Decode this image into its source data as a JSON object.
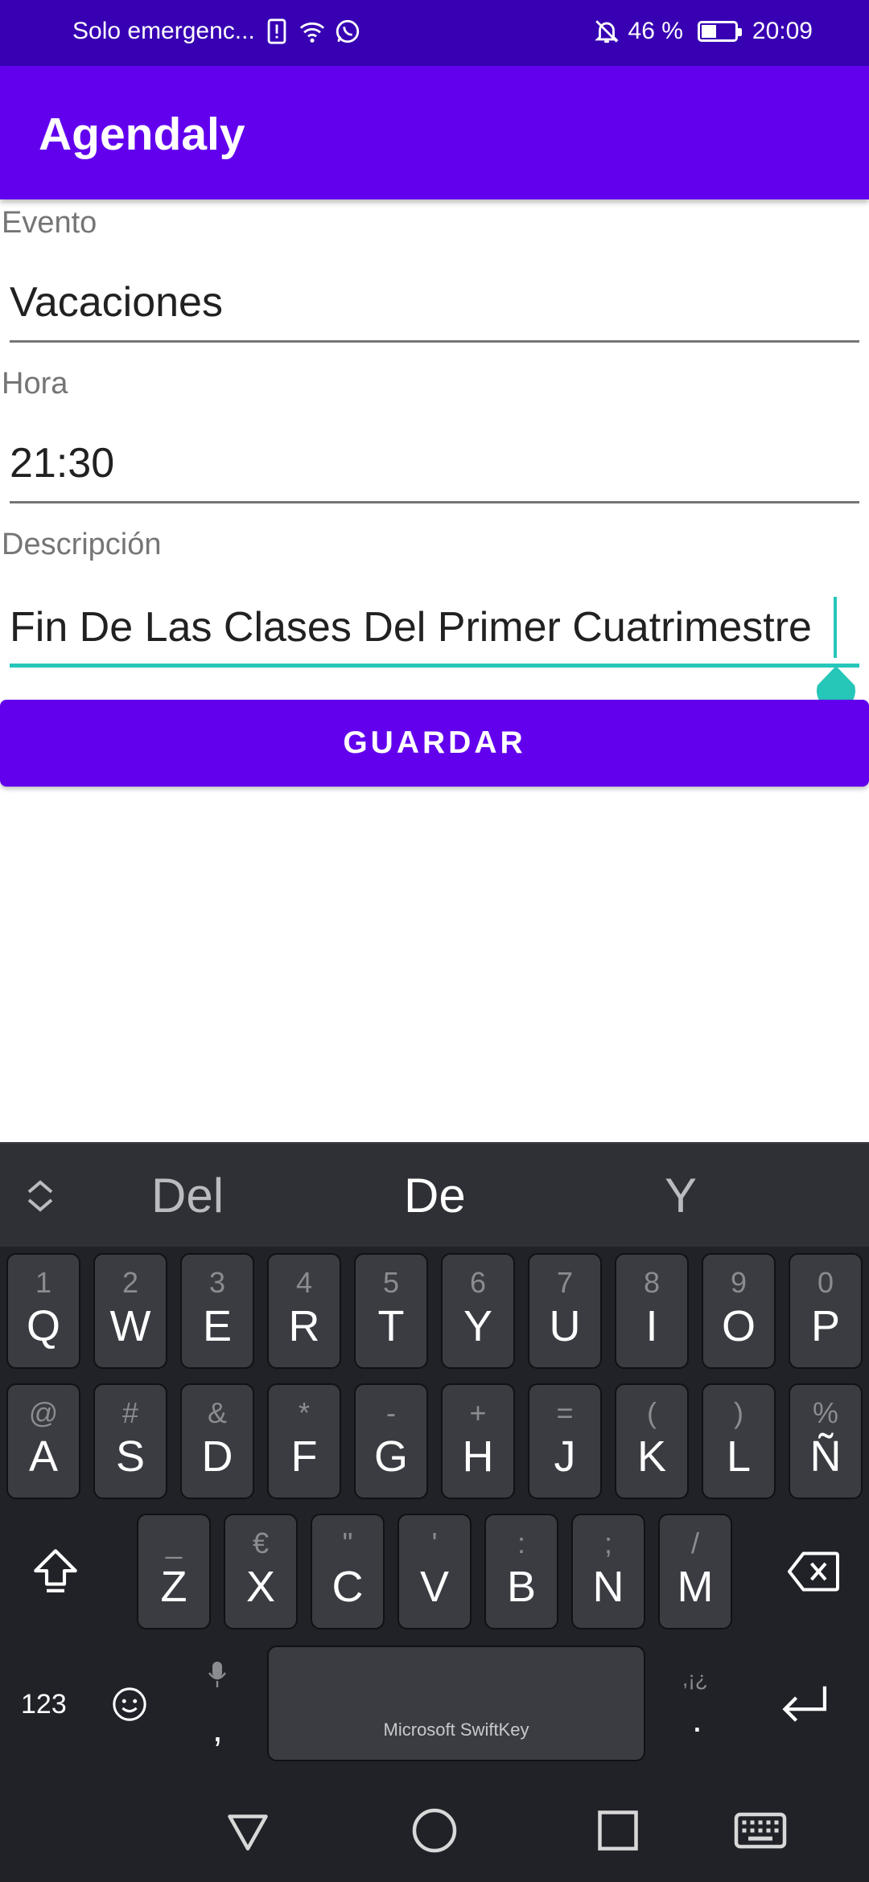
{
  "status_bar": {
    "carrier": "Solo emergenc...",
    "battery_percent": "46 %",
    "battery_level": 0.46,
    "time": "20:09"
  },
  "app_bar": {
    "title": "Agendaly"
  },
  "form": {
    "event_label": "Evento",
    "event_value": "Vacaciones",
    "time_label": "Hora",
    "time_value": "21:30",
    "description_label": "Descripción",
    "description_value": "Fin De Las Clases Del Primer Cuatrimestre",
    "save_label": "GUARDAR"
  },
  "keyboard": {
    "suggestions": [
      "Del",
      "De",
      "Y"
    ],
    "row1": [
      {
        "main": "Q",
        "hint": "1"
      },
      {
        "main": "W",
        "hint": "2"
      },
      {
        "main": "E",
        "hint": "3"
      },
      {
        "main": "R",
        "hint": "4"
      },
      {
        "main": "T",
        "hint": "5"
      },
      {
        "main": "Y",
        "hint": "6"
      },
      {
        "main": "U",
        "hint": "7"
      },
      {
        "main": "I",
        "hint": "8"
      },
      {
        "main": "O",
        "hint": "9"
      },
      {
        "main": "P",
        "hint": "0"
      }
    ],
    "row2": [
      {
        "main": "A",
        "hint": "@"
      },
      {
        "main": "S",
        "hint": "#"
      },
      {
        "main": "D",
        "hint": "&"
      },
      {
        "main": "F",
        "hint": "*"
      },
      {
        "main": "G",
        "hint": "-"
      },
      {
        "main": "H",
        "hint": "+"
      },
      {
        "main": "J",
        "hint": "="
      },
      {
        "main": "K",
        "hint": "("
      },
      {
        "main": "L",
        "hint": ")"
      },
      {
        "main": "Ñ",
        "hint": "%"
      }
    ],
    "row3": [
      {
        "main": "Z",
        "hint": "_"
      },
      {
        "main": "X",
        "hint": "€"
      },
      {
        "main": "C",
        "hint": "\""
      },
      {
        "main": "V",
        "hint": "'"
      },
      {
        "main": "B",
        "hint": ":"
      },
      {
        "main": "N",
        "hint": ";"
      },
      {
        "main": "M",
        "hint": "/"
      }
    ],
    "numbers_label": "123",
    "comma_label": ",",
    "space_brand": "Microsoft SwiftKey",
    "period_label": ".",
    "punct_hint": ",¡¿"
  },
  "icons": {
    "alert": "alert-icon",
    "wifi": "wifi-icon",
    "whatsapp": "whatsapp-icon",
    "mute": "notifications-off-icon",
    "battery": "battery-icon",
    "shift": "shift-icon",
    "backspace": "backspace-icon",
    "emoji": "emoji-icon",
    "mic": "mic-icon",
    "enter": "enter-icon",
    "back": "back-icon",
    "home": "home-icon",
    "recents": "recents-icon",
    "keyboard": "keyboard-icon"
  },
  "colors": {
    "primary": "#6200ee",
    "primary_dark": "#3700b3",
    "accent": "#26c6b9",
    "keyboard_bg": "#202228",
    "key_bg": "#3a3c42"
  }
}
